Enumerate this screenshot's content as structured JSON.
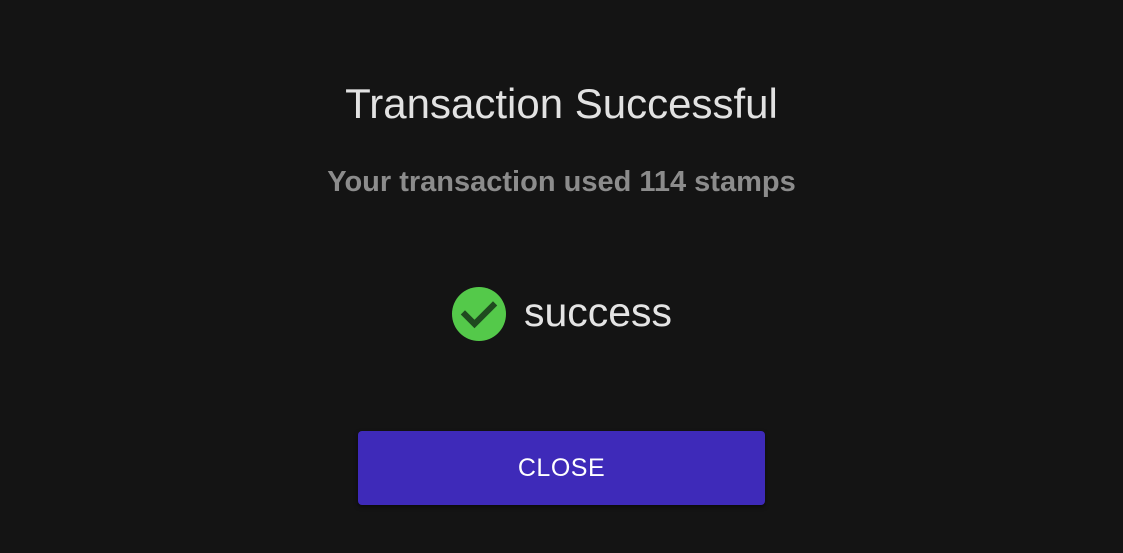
{
  "dialog": {
    "title": "Transaction Successful",
    "subtitle": "Your transaction used 114 stamps",
    "status": {
      "icon": "check-circle-icon",
      "icon_color": "#54c94a",
      "label": "success"
    },
    "close_button_label": "CLOSE"
  },
  "colors": {
    "background": "#141414",
    "title": "#e2e2e2",
    "subtitle": "#8c8c8c",
    "button": "#3e2ab9",
    "button_text": "#ffffff"
  }
}
